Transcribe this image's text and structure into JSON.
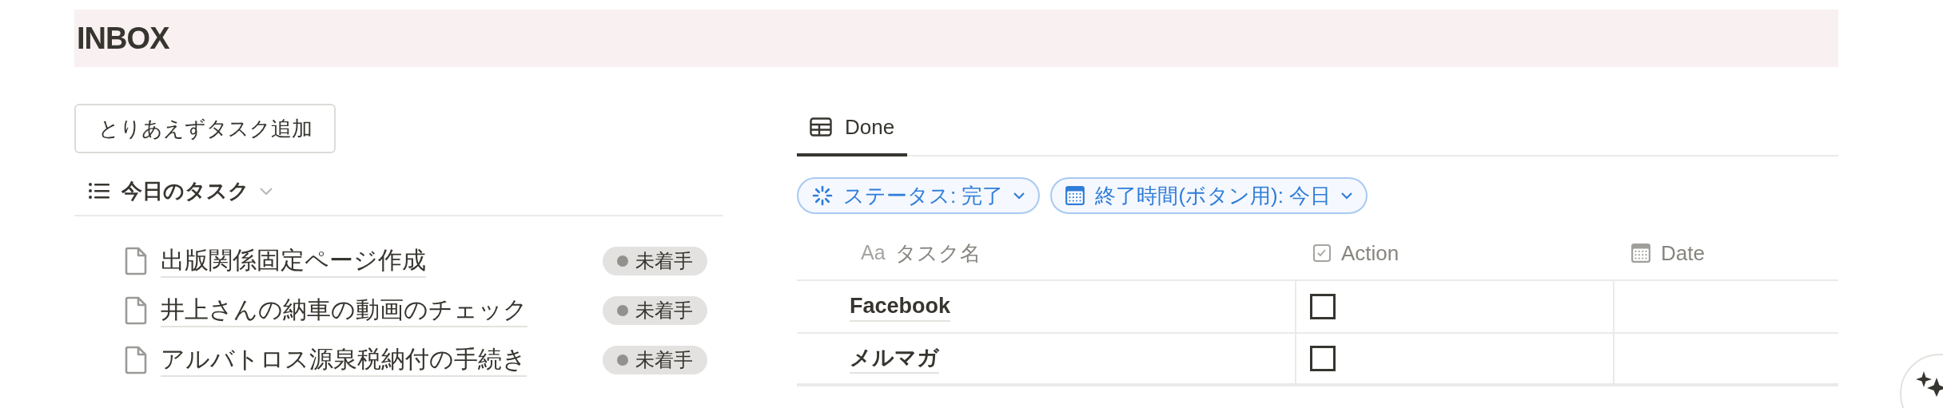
{
  "page": {
    "title": "INBOX"
  },
  "left": {
    "add_button": "とりあえずタスク追加",
    "list_view": {
      "label": "今日のタスク"
    },
    "tasks": [
      {
        "title": "出版関係固定ページ作成",
        "status": "未着手"
      },
      {
        "title": "井上さんの納車の動画のチェック",
        "status": "未着手"
      },
      {
        "title": "アルバトロス源泉税納付の手続き",
        "status": "未着手"
      }
    ]
  },
  "right": {
    "tabs": [
      {
        "label": "Done",
        "selected": true
      }
    ],
    "filters": [
      {
        "kind": "status",
        "label": "ステータス: 完了"
      },
      {
        "kind": "date",
        "label": "終了時間(ボタン用): 今日"
      }
    ],
    "table": {
      "columns": [
        {
          "kind": "title",
          "icon": "Aa",
          "label": "タスク名"
        },
        {
          "kind": "checkbox",
          "label": "Action"
        },
        {
          "kind": "date",
          "label": "Date"
        }
      ],
      "rows": [
        {
          "name": "Facebook",
          "action": {
            "checked": false
          }
        },
        {
          "name": "メルマガ",
          "action": {
            "checked": false
          }
        }
      ]
    }
  }
}
